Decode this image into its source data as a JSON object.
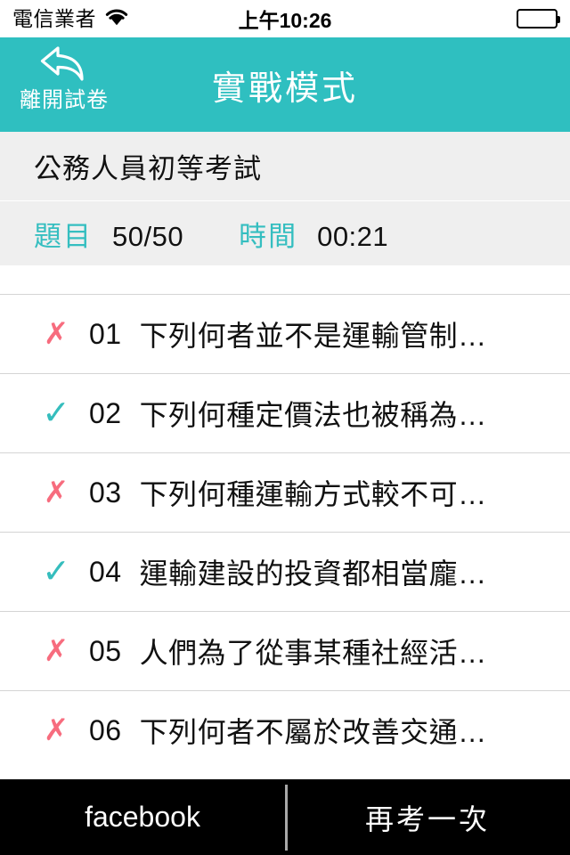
{
  "status_bar": {
    "carrier": "電信業者",
    "wifi_icon": "wifi-icon",
    "time": "上午10:26",
    "battery_icon": "battery-full-icon"
  },
  "nav_bar": {
    "back_icon": "back-arrow-icon",
    "back_label": "離開試卷",
    "title": "實戰模式",
    "background_color": "#2FBFC0"
  },
  "exam": {
    "title": "公務人員初等考試"
  },
  "stats": [
    {
      "label": "題目",
      "value": "50/50"
    },
    {
      "label": "時間",
      "value": "00:21"
    }
  ],
  "questions": [
    {
      "mark": "✗",
      "mark_state": "wrong",
      "number": "01",
      "text": "下列何者並不是運輸管制…"
    },
    {
      "mark": "✓",
      "mark_state": "correct",
      "number": "02",
      "text": "下列何種定價法也被稱為…"
    },
    {
      "mark": "✗",
      "mark_state": "wrong",
      "number": "03",
      "text": "下列何種運輸方式較不可…"
    },
    {
      "mark": "✓",
      "mark_state": "correct",
      "number": "04",
      "text": "運輸建設的投資都相當龐…"
    },
    {
      "mark": "✗",
      "mark_state": "wrong",
      "number": "05",
      "text": "人們為了從事某種社經活…"
    },
    {
      "mark": "✗",
      "mark_state": "wrong",
      "number": "06",
      "text": "下列何者不屬於改善交通…"
    }
  ],
  "toolbar": {
    "facebook_label": "facebook",
    "retry_label": "再考一次"
  },
  "colors": {
    "accent_teal": "#2FBFC0",
    "correct_teal": "#35BDBD",
    "wrong_red": "#F76C7E",
    "band_gray": "#EFEFEF",
    "toolbar_black": "#000000"
  }
}
